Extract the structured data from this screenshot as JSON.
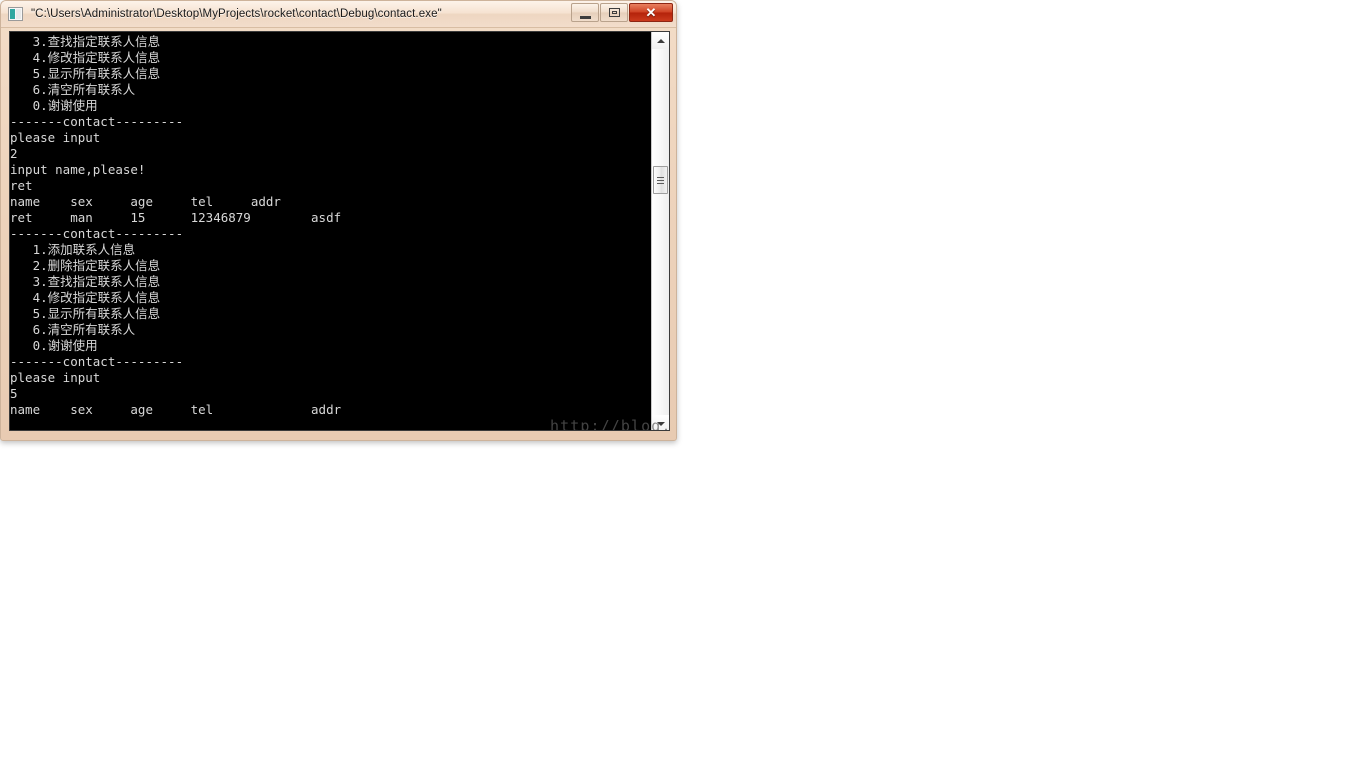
{
  "window": {
    "title": "\"C:\\Users\\Administrator\\Desktop\\MyProjects\\rocket\\contact\\Debug\\contact.exe\"",
    "icon_name": "console-app-icon",
    "controls": {
      "minimize_label": "–",
      "maximize_label": "□",
      "close_label": "✕"
    },
    "frame_color": "#eed4bd",
    "titlebar_color": "#f6e3d2",
    "close_color": "#cf4224"
  },
  "console": {
    "background": "#000000",
    "foreground": "#d8d8d8",
    "lines": [
      "   3.查找指定联系人信息",
      "   4.修改指定联系人信息",
      "   5.显示所有联系人信息",
      "   6.清空所有联系人",
      "   0.谢谢使用",
      "-------contact---------",
      "please input",
      "2",
      "input name,please!",
      "ret",
      "name    sex     age     tel     addr",
      "ret     man     15      12346879        asdf",
      "-------contact---------",
      "   1.添加联系人信息",
      "   2.删除指定联系人信息",
      "   3.查找指定联系人信息",
      "   4.修改指定联系人信息",
      "   5.显示所有联系人信息",
      "   6.清空所有联系人",
      "   0.谢谢使用",
      "-------contact---------",
      "please input",
      "5",
      "name    sex     age     tel             addr"
    ]
  },
  "scrollbar": {
    "up_arrow_name": "scroll-up-arrow",
    "down_arrow_name": "scroll-down-arrow",
    "thumb_name": "scrollbar-thumb"
  },
  "watermark": {
    "text": "http://blog.csdn.net/ret_skd"
  }
}
